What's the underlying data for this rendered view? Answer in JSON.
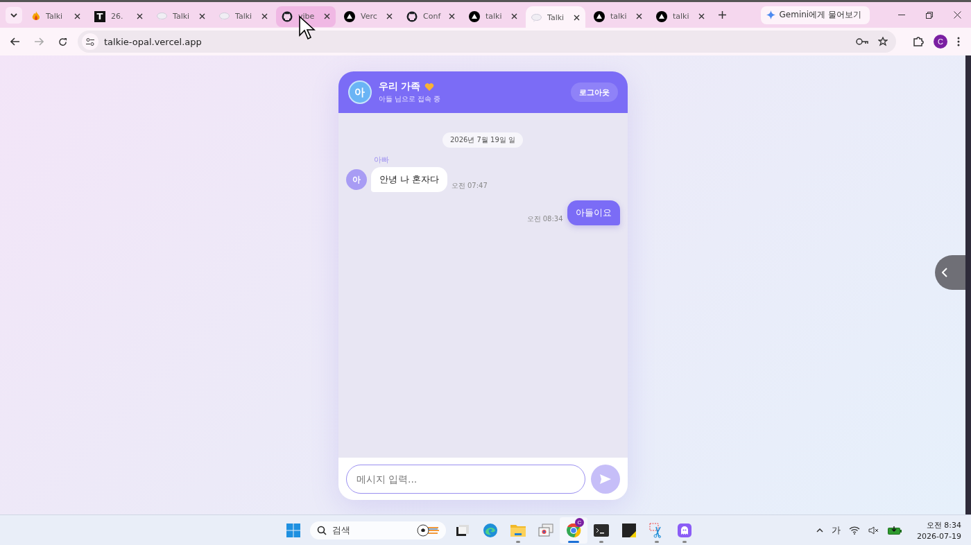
{
  "browser": {
    "tabs": [
      {
        "kind": "fire",
        "title": "Talki",
        "selected": false,
        "hovered": false
      },
      {
        "kind": "letter",
        "icon_text": "T",
        "title": "26.",
        "selected": false,
        "hovered": false
      },
      {
        "kind": "bubble",
        "title": "Talki",
        "selected": false,
        "hovered": false
      },
      {
        "kind": "bubble",
        "title": "Talki",
        "selected": false,
        "hovered": false
      },
      {
        "kind": "github",
        "title": "vibe",
        "selected": false,
        "hovered": true
      },
      {
        "kind": "triangle",
        "title": "Verc",
        "selected": false,
        "hovered": false
      },
      {
        "kind": "github",
        "title": "Conf",
        "selected": false,
        "hovered": false
      },
      {
        "kind": "triangle",
        "title": "talki",
        "selected": false,
        "hovered": false
      },
      {
        "kind": "bubble",
        "title": "Talki",
        "selected": true,
        "hovered": false
      },
      {
        "kind": "triangle",
        "title": "talki",
        "selected": false,
        "hovered": false
      },
      {
        "kind": "triangle",
        "title": "talki",
        "selected": false,
        "hovered": false
      }
    ],
    "gemini_button": "Gemini에게 물어보기",
    "url": "talkie-opal.vercel.app",
    "profile": "C"
  },
  "chat": {
    "avatar": "아",
    "title": "우리 가족",
    "subtitle": "아들 님으로 접속 중",
    "logout": "로그아웃",
    "date": "2026년 7월 19일 일",
    "messages": [
      {
        "kind": "received",
        "sender": "아빠",
        "avatar": "아",
        "text": "안녕 나 혼자다",
        "time": "오전 07:47"
      },
      {
        "kind": "sent",
        "text": "아들이요",
        "time": "오전 08:34"
      }
    ],
    "input_placeholder": "메시지 입력..."
  },
  "taskbar": {
    "search_placeholder": "검색",
    "apps": [
      {
        "kind": "taskview",
        "running": false,
        "selected": false
      },
      {
        "kind": "edge",
        "running": false,
        "selected": false
      },
      {
        "kind": "folder",
        "running": true,
        "selected": false
      },
      {
        "kind": "windows",
        "running": false,
        "selected": false
      },
      {
        "kind": "chrome",
        "running": true,
        "selected": true,
        "badge": "C"
      },
      {
        "kind": "terminal",
        "running": true,
        "selected": false
      },
      {
        "kind": "sticky",
        "running": false,
        "selected": false
      },
      {
        "kind": "snip",
        "running": true,
        "selected": false
      },
      {
        "kind": "ghost",
        "running": true,
        "selected": false
      }
    ],
    "ime": "가",
    "time": "오전 8:34",
    "date": "2026-07-19"
  }
}
